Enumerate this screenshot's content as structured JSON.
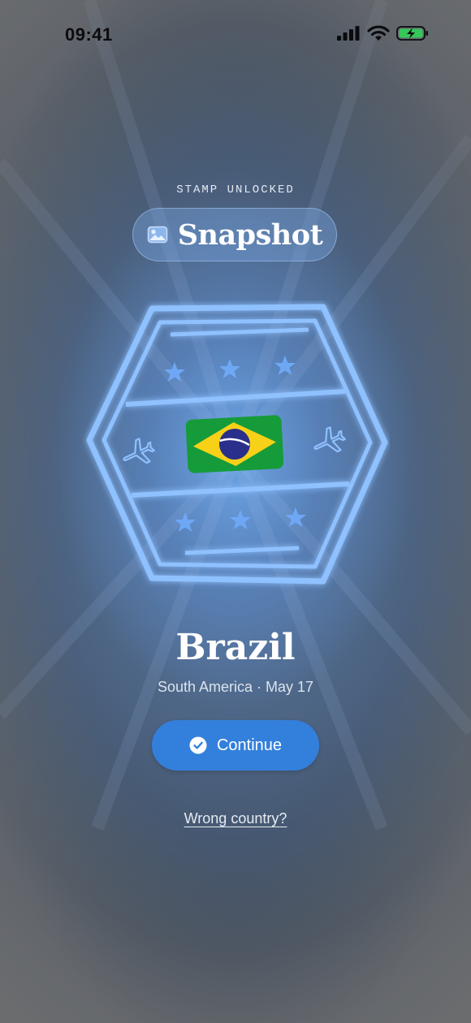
{
  "status_bar": {
    "time": "09:41"
  },
  "stamp_header": {
    "eyebrow": "STAMP UNLOCKED",
    "stamp_name": "Snapshot"
  },
  "stamp": {
    "flag": "Brazil flag",
    "icons": [
      "star-icon",
      "airplane-icon"
    ]
  },
  "destination": {
    "country": "Brazil",
    "meta": "South America · May 17"
  },
  "actions": {
    "continue_label": "Continue",
    "wrong_country_label": "Wrong country?"
  },
  "colors": {
    "accent": "#3380dc",
    "stamp": "#8fc1ff",
    "battery": "#34c759"
  }
}
